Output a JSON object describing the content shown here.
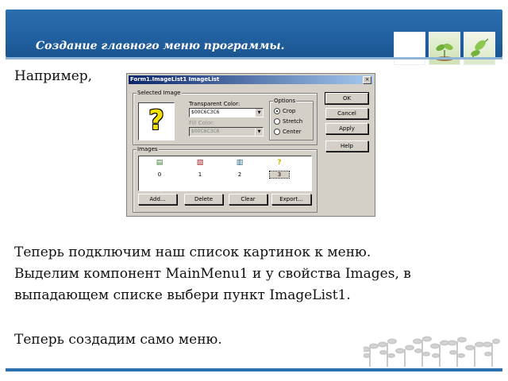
{
  "slide": {
    "title": "Создание главного меню программы.",
    "intro": "Например,",
    "paragraph_lines": [
      "Теперь подключим наш список картинок к меню.",
      " Выделим компонент MainMenu1 и у свойства Images, в",
      "выпадающем списке выбери пункт ImageList1."
    ],
    "closing": "Теперь создадим само меню."
  },
  "colors": {
    "header_blue": "#2160a0",
    "dialog_face": "#d4d0c8",
    "title_active": "#0a246a"
  },
  "dialog": {
    "title": "Form1.ImageList1 ImageList",
    "close_label": "×",
    "selected_image": {
      "group_label": "Selected Image",
      "preview_icon": "question-mark-icon",
      "preview_glyph": "?",
      "transparent_label": "Transparent Color:",
      "transparent_value": "$00C6C3C6",
      "fill_label": "Fill Color:",
      "fill_value": "$00C6C3C6"
    },
    "options": {
      "label": "Options",
      "items": [
        {
          "label": "Crop",
          "checked": true
        },
        {
          "label": "Stretch",
          "checked": false
        },
        {
          "label": "Center",
          "checked": false
        }
      ]
    },
    "buttons": {
      "ok": "OK",
      "cancel": "Cancel",
      "apply": "Apply",
      "help": "Help"
    },
    "images": {
      "label": "Images",
      "items": [
        {
          "index": "0",
          "icon": "document-icon",
          "glyph": "▤",
          "color": "#3a7d2a"
        },
        {
          "index": "1",
          "icon": "document-edit-icon",
          "glyph": "▧",
          "color": "#a02020"
        },
        {
          "index": "2",
          "icon": "network-document-icon",
          "glyph": "▥",
          "color": "#206080"
        },
        {
          "index": "3",
          "icon": "question-mark-icon",
          "glyph": "?",
          "color": "#c8b800"
        }
      ],
      "selected_index": "3"
    },
    "image_buttons": {
      "add": "Add...",
      "delete": "Delete",
      "clear": "Clear",
      "export": "Export..."
    }
  }
}
